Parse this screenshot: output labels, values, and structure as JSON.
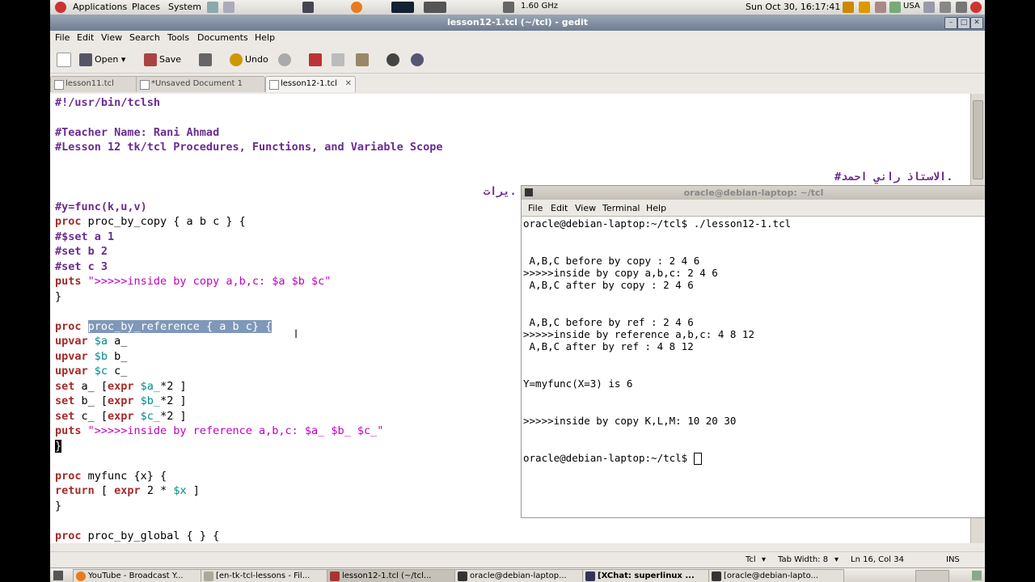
{
  "top_panel": {
    "applications": "Applications",
    "places": "Places",
    "system": "System",
    "cpu_freq": "1.60 GHz",
    "clock": "Sun Oct 30, 16:17:41",
    "keyboard": "USA"
  },
  "gedit": {
    "title": "lesson12-1.tcl (~/tcl) - gedit",
    "menu": [
      "File",
      "Edit",
      "View",
      "Search",
      "Tools",
      "Documents",
      "Help"
    ],
    "toolbar": {
      "open": "Open",
      "save": "Save",
      "undo": "Undo"
    },
    "tabs": [
      {
        "label": "lesson11.tcl"
      },
      {
        "label": "*Unsaved Document 1"
      },
      {
        "label": "lesson12-1.tcl",
        "close": "✕"
      }
    ],
    "code": {
      "shebang": "#!/usr/bin/tclsh",
      "comment1": "#Teacher Name: Rani Ahmad",
      "comment2": "#Lesson 12 tk/tcl Procedures, Functions, and Variable Scope",
      "arabic1": "#الاستاذ راني احمد.",
      "arabic2": "يرات.",
      "l_func": "#y=func(k,u,v)",
      "l_proc": "proc",
      "l_copy_sig": " proc_by_copy { a b c } {",
      "l_set_a": "#$set a 1",
      "l_set_b": "#set b 2",
      "l_set_c": "#set c 3",
      "l_puts": "puts",
      "l_puts_copy_str": " \">>>>>inside by copy a,b,c: $a $b $c\"",
      "l_close": "}",
      "l_ref_sig": "proc_by_reference { a b c} {",
      "l_upvar": "upvar",
      "l_upvar_a_var": " $a",
      "l_upvar_a_rest": " a_",
      "l_upvar_b_var": " $b",
      "l_upvar_b_rest": " b_",
      "l_upvar_c_var": " $c",
      "l_upvar_c_rest": " c_",
      "l_set": "set",
      "l_seta_mid": " a_ [",
      "l_expr": "expr",
      "l_seta_var": " $a_",
      "l_seta_end": "*2 ]",
      "l_setb_mid": " b_ [",
      "l_setb_var": " $b_",
      "l_setb_end": "*2 ]",
      "l_setc_mid": " c_ [",
      "l_setc_var": " $c_",
      "l_setc_end": "*2 ]",
      "l_puts_ref_str": " \">>>>>inside by reference a,b,c: $a_ $b_ $c_\"",
      "l_myfunc_sig": " myfunc {x} {",
      "l_return": "return",
      "l_return_mid": " [ ",
      "l_return_expr": "expr",
      "l_return_2": " 2 * ",
      "l_return_var": "$x",
      "l_return_end": " ]",
      "l_global_sig": " proc_by_global { } {"
    },
    "status": {
      "language": "Tcl",
      "tab_width": "Tab Width: 8",
      "position": "Ln 16, Col 34",
      "mode": "INS"
    }
  },
  "terminal": {
    "title": "oracle@debian-laptop: ~/tcl",
    "menu": [
      "File",
      "Edit",
      "View",
      "Terminal",
      "Help"
    ],
    "lines": [
      "oracle@debian-laptop:~/tcl$ ./lesson12-1.tcl",
      "",
      "",
      " A,B,C before by copy : 2 4 6",
      ">>>>>inside by copy a,b,c: 2 4 6",
      " A,B,C after by copy : 2 4 6",
      "",
      "",
      " A,B,C before by ref : 2 4 6",
      ">>>>>inside by reference a,b,c: 4 8 12",
      " A,B,C after by ref : 4 8 12",
      "",
      "",
      "Y=myfunc(X=3) is 6",
      "",
      "",
      ">>>>>inside by copy K,L,M: 10 20 30",
      "",
      "",
      "oracle@debian-laptop:~/tcl$ "
    ]
  },
  "taskbar": [
    {
      "label": "YouTube - Broadcast Y..."
    },
    {
      "label": "[en-tk-tcl-lessons - Fil..."
    },
    {
      "label": "lesson12-1.tcl (~/tcl..."
    },
    {
      "label": "oracle@debian-laptop..."
    },
    {
      "label": "[XChat: superlinux ..."
    },
    {
      "label": "[oracle@debian-lapto..."
    }
  ]
}
